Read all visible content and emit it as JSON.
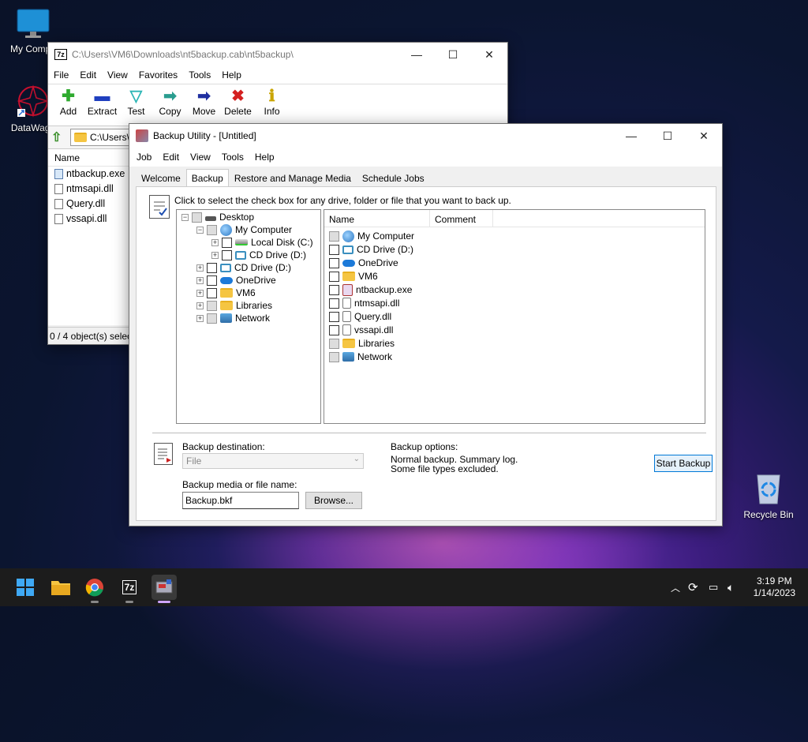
{
  "desktop": {
    "icons": [
      {
        "label": "My Compu",
        "icon": "monitor-icon"
      },
      {
        "label": "DataWago",
        "icon": "datawagon-icon"
      },
      {
        "label": "Recycle Bin",
        "icon": "recycle-bin-icon"
      }
    ]
  },
  "sevenzip": {
    "title": "C:\\Users\\VM6\\Downloads\\nt5backup.cab\\nt5backup\\",
    "menu": [
      "File",
      "Edit",
      "View",
      "Favorites",
      "Tools",
      "Help"
    ],
    "toolbar": [
      {
        "label": "Add",
        "icon": "plus-icon",
        "glyph": "✚",
        "color": "#2faa2f"
      },
      {
        "label": "Extract",
        "icon": "minus-icon",
        "glyph": "▬",
        "color": "#1f3fbf"
      },
      {
        "label": "Test",
        "icon": "check-arrow-icon",
        "glyph": "▽",
        "color": "#2cb5b5"
      },
      {
        "label": "Copy",
        "icon": "copy-arrow-icon",
        "glyph": "➡",
        "color": "#2a9d8f"
      },
      {
        "label": "Move",
        "icon": "move-arrow-icon",
        "glyph": "➡",
        "color": "#1f2fa0"
      },
      {
        "label": "Delete",
        "icon": "delete-x-icon",
        "glyph": "✖",
        "color": "#d42020"
      },
      {
        "label": "Info",
        "icon": "info-icon",
        "glyph": "ℹ",
        "color": "#c9a400"
      }
    ],
    "address": "C:\\Users\\",
    "column_name": "Name",
    "files": [
      {
        "name": "ntbackup.exe",
        "type": "exe"
      },
      {
        "name": "ntmsapi.dll",
        "type": "dll"
      },
      {
        "name": "Query.dll",
        "type": "dll"
      },
      {
        "name": "vssapi.dll",
        "type": "dll"
      }
    ],
    "status": "0 / 4 object(s) selec"
  },
  "backup": {
    "title": "Backup Utility - [Untitled]",
    "menu": [
      "Job",
      "Edit",
      "View",
      "Tools",
      "Help"
    ],
    "tabs": [
      "Welcome",
      "Backup",
      "Restore and Manage Media",
      "Schedule Jobs"
    ],
    "active_tab": "Backup",
    "instruction": "Click to select the check box for any drive, folder or file that you want to back up.",
    "tree": [
      {
        "label": "Desktop",
        "icon": "desktop-icon",
        "expander": "−",
        "grey": true
      },
      {
        "label": "My Computer",
        "icon": "my-computer-icon",
        "expander": "−",
        "grey": true
      },
      {
        "label": "Local Disk (C:)",
        "icon": "local-disk-icon",
        "expander": "+",
        "grey": false
      },
      {
        "label": "CD Drive (D:)",
        "icon": "cd-drive-icon",
        "expander": "+",
        "grey": false
      },
      {
        "label": "CD Drive (D:)",
        "icon": "cd-drive-icon",
        "expander": "+",
        "grey": false
      },
      {
        "label": "OneDrive",
        "icon": "onedrive-icon",
        "expander": "+",
        "grey": false
      },
      {
        "label": "VM6",
        "icon": "folder-icon",
        "expander": "+",
        "grey": false
      },
      {
        "label": "Libraries",
        "icon": "libraries-icon",
        "expander": "+",
        "grey": true
      },
      {
        "label": "Network",
        "icon": "network-icon",
        "expander": "+",
        "grey": true
      }
    ],
    "list_columns": [
      "Name",
      "Comment"
    ],
    "list_items": [
      {
        "label": "My Computer",
        "icon": "my-computer-icon",
        "grey": true
      },
      {
        "label": "CD Drive (D:)",
        "icon": "cd-drive-icon",
        "grey": false
      },
      {
        "label": "OneDrive",
        "icon": "onedrive-icon",
        "grey": false
      },
      {
        "label": "VM6",
        "icon": "folder-icon",
        "grey": false
      },
      {
        "label": "ntbackup.exe",
        "icon": "exe-file-icon",
        "grey": false
      },
      {
        "label": "ntmsapi.dll",
        "icon": "dll-file-icon",
        "grey": false
      },
      {
        "label": "Query.dll",
        "icon": "dll-file-icon",
        "grey": false
      },
      {
        "label": "vssapi.dll",
        "icon": "dll-file-icon",
        "grey": false
      },
      {
        "label": "Libraries",
        "icon": "libraries-icon",
        "grey": true
      },
      {
        "label": "Network",
        "icon": "network-icon",
        "grey": true
      }
    ],
    "destination_label": "Backup destination:",
    "destination_value": "File",
    "media_label": "Backup media or file name:",
    "media_value": "Backup.bkf",
    "browse_label": "Browse...",
    "options_label": "Backup options:",
    "options_line1": "Normal backup.  Summary log.",
    "options_line2": "Some file types excluded.",
    "start_label": "Start Backup"
  },
  "taskbar": {
    "apps": [
      "start-icon",
      "file-explorer-icon",
      "chrome-icon",
      "7zip-icon",
      "backup-utility-icon"
    ],
    "time": "3:19 PM",
    "date": "1/14/2023"
  }
}
